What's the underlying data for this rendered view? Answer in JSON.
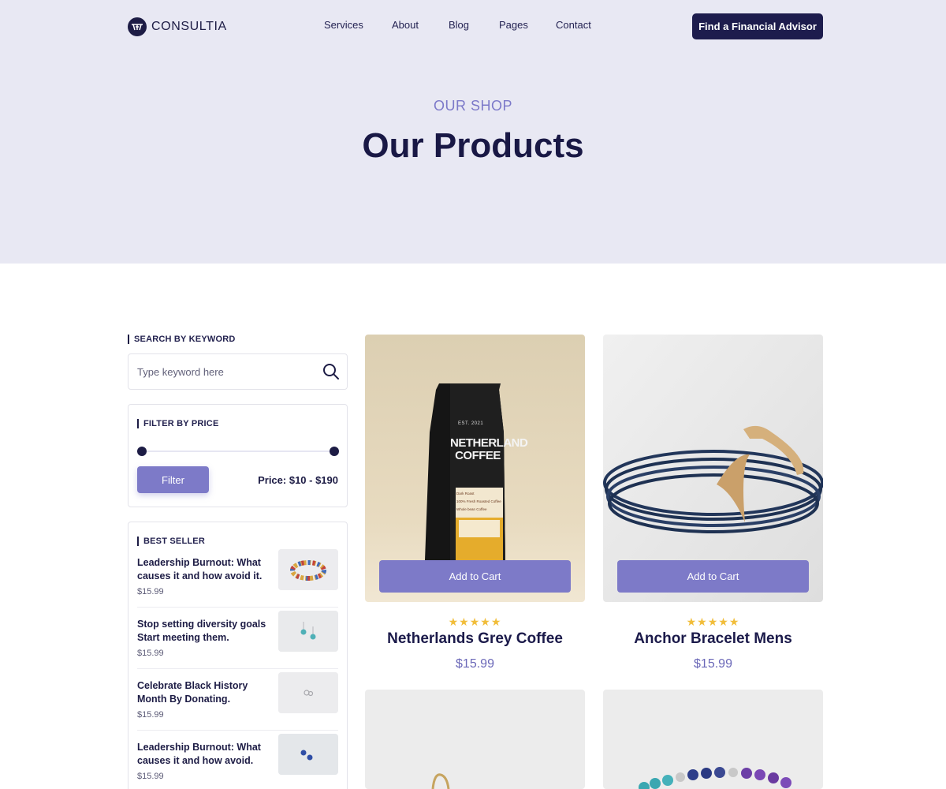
{
  "brand": {
    "name": "CONSULTIA"
  },
  "nav": {
    "items": [
      "Services",
      "About",
      "Blog",
      "Pages",
      "Contact"
    ],
    "cta_label": "Find a Financial Advisor"
  },
  "hero": {
    "eyebrow": "OUR SHOP",
    "title": "Our Products"
  },
  "sidebar": {
    "search": {
      "label": "SEARCH BY KEYWORD",
      "placeholder": "Type keyword here",
      "icon": "search-icon"
    },
    "price_filter": {
      "label": "FILTER BY PRICE",
      "button_label": "Filter",
      "range_text": "Price: $10 - $190",
      "min_value": 10,
      "max_value": 190
    },
    "best_seller": {
      "label": "BEST SELLER",
      "items": [
        {
          "title": "Leadership Burnout: What causes it and how avoid it.",
          "price": "$15.99"
        },
        {
          "title": "Stop setting diversity goals Start meeting them.",
          "price": "$15.99"
        },
        {
          "title": "Celebrate Black History Month By Donating.",
          "price": "$15.99"
        },
        {
          "title": "Leadership Burnout: What causes it and how avoid.",
          "price": "$15.99"
        }
      ]
    }
  },
  "products": [
    {
      "name": "Netherlands Grey Coffee",
      "price": "$15.99",
      "rating": 5,
      "button_label": "Add to Cart",
      "bag": {
        "label_top": "EST. 2021",
        "title_line1": "NETHERLAND",
        "title_line2": "COFFEE",
        "label_lines": [
          "Dark Roast",
          "100% Fresh Roasted Coffee",
          "Whole bean Coffee"
        ]
      }
    },
    {
      "name": "Anchor Bracelet Mens",
      "price": "$15.99",
      "rating": 5,
      "button_label": "Add to Cart"
    },
    {
      "name": "",
      "price": ""
    },
    {
      "name": "",
      "price": ""
    }
  ],
  "colors": {
    "hero_bg": "#e8e8f3",
    "accent": "#7d7ac8",
    "dark": "#1d1c45",
    "star": "#f1bd3a"
  }
}
